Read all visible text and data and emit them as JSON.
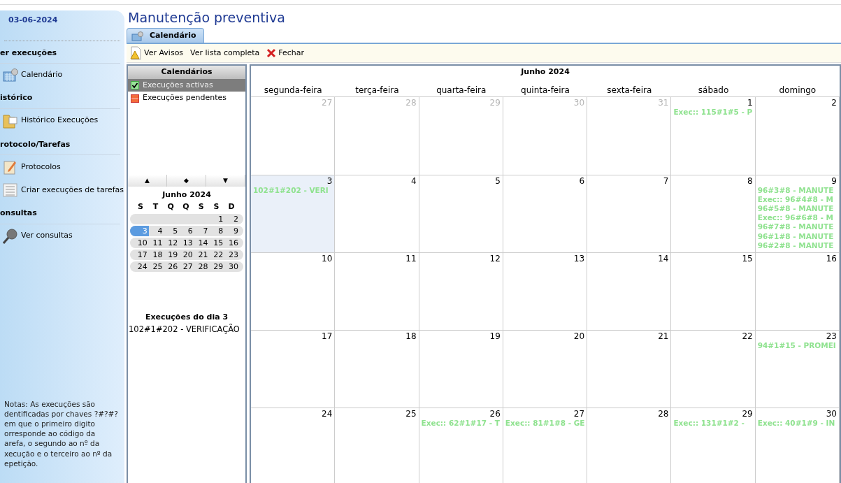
{
  "sidebar": {
    "date": "03-06-2024",
    "sections": [
      {
        "title": "er execuções",
        "items": [
          {
            "label": "Calendário",
            "kind": "calendar"
          }
        ]
      },
      {
        "title": "istórico",
        "items": [
          {
            "label": "Histórico Execuções",
            "kind": "folder"
          }
        ]
      },
      {
        "title": "rotocolo/Tarefas",
        "items": [
          {
            "label": "Protocolos",
            "kind": "clipboard"
          },
          {
            "label": "Criar execuções de tarefas",
            "kind": "list"
          }
        ]
      },
      {
        "title": "onsultas",
        "items": [
          {
            "label": "Ver consultas",
            "kind": "search"
          }
        ]
      }
    ],
    "notes_lines": [
      "Notas: As execuções são",
      "dentificadas por chaves ?#?#?",
      "em que o primeiro digito",
      "orresponde ao código da",
      "arefa, o segundo ao nº da",
      "xecução e o terceiro ao nº da",
      "epetição."
    ]
  },
  "title": "Manutenção preventiva",
  "tabs": [
    {
      "label": "Calendário",
      "selected": true
    }
  ],
  "toolbar": [
    {
      "label": "Ver Avisos",
      "kind": "warning"
    },
    {
      "label": "Ver lista completa",
      "kind": "plain"
    },
    {
      "label": "Fechar",
      "kind": "close"
    }
  ],
  "calendars": {
    "title": "Calendários",
    "items": [
      {
        "label": "Execuções activas",
        "kind": "active",
        "selected": true,
        "checked": true
      },
      {
        "label": "Execuções pendentes",
        "kind": "pending",
        "selected": false,
        "checked": false
      }
    ]
  },
  "nav_buttons": [
    "▲",
    "◆",
    "▼"
  ],
  "mini_calendar": {
    "title": "Junho 2024",
    "weekdays": [
      "S",
      "T",
      "Q",
      "Q",
      "S",
      "S",
      "D"
    ],
    "weeks": [
      {
        "kind": "first",
        "days": [
          {
            "day": "1",
            "selected": false
          },
          {
            "day": "2",
            "selected": false
          }
        ]
      },
      [
        {
          "day": "3",
          "selected": true
        },
        {
          "day": "4",
          "selected": false
        },
        {
          "day": "5",
          "selected": false
        },
        {
          "day": "6",
          "selected": false
        },
        {
          "day": "7",
          "selected": false
        },
        {
          "day": "8",
          "selected": false
        },
        {
          "day": "9",
          "selected": false
        }
      ],
      [
        {
          "day": "10",
          "selected": false
        },
        {
          "day": "11",
          "selected": false
        },
        {
          "day": "12",
          "selected": false
        },
        {
          "day": "13",
          "selected": false
        },
        {
          "day": "14",
          "selected": false
        },
        {
          "day": "15",
          "selected": false
        },
        {
          "day": "16",
          "selected": false
        }
      ],
      [
        {
          "day": "17",
          "selected": false
        },
        {
          "day": "18",
          "selected": false
        },
        {
          "day": "19",
          "selected": false
        },
        {
          "day": "20",
          "selected": false
        },
        {
          "day": "21",
          "selected": false
        },
        {
          "day": "22",
          "selected": false
        },
        {
          "day": "23",
          "selected": false
        }
      ],
      [
        {
          "day": "24",
          "selected": false
        },
        {
          "day": "25",
          "selected": false
        },
        {
          "day": "26",
          "selected": false
        },
        {
          "day": "27",
          "selected": false
        },
        {
          "day": "28",
          "selected": false
        },
        {
          "day": "29",
          "selected": false
        },
        {
          "day": "30",
          "selected": false
        }
      ]
    ]
  },
  "day_executions": {
    "title": "Execuções do dia 3",
    "items": [
      "102#1#202 - VERIFICAÇÃO"
    ]
  },
  "month_view": {
    "title": "Junho 2024",
    "weekdays": [
      "segunda-feira",
      "terça-feira",
      "quarta-feira",
      "quinta-feira",
      "sexta-feira",
      "sábado",
      "domingo"
    ],
    "weeks": [
      [
        {
          "day": "27",
          "other_month": true,
          "selected": false
        },
        {
          "day": "28",
          "other_month": true,
          "selected": false
        },
        {
          "day": "29",
          "other_month": true,
          "selected": false
        },
        {
          "day": "30",
          "other_month": true,
          "selected": false
        },
        {
          "day": "31",
          "other_month": true,
          "selected": false
        },
        {
          "day": "1",
          "other_month": false,
          "selected": false,
          "events": [
            "Exec:: 115#1#5 - P"
          ]
        },
        {
          "day": "2",
          "other_month": false,
          "selected": false
        }
      ],
      [
        {
          "day": "3",
          "other_month": false,
          "selected": true,
          "events": [
            "102#1#202 - VERI"
          ]
        },
        {
          "day": "4",
          "other_month": false,
          "selected": false
        },
        {
          "day": "5",
          "other_month": false,
          "selected": false
        },
        {
          "day": "6",
          "other_month": false,
          "selected": false
        },
        {
          "day": "7",
          "other_month": false,
          "selected": false
        },
        {
          "day": "8",
          "other_month": false,
          "selected": false
        },
        {
          "day": "9",
          "other_month": false,
          "selected": false,
          "events": [
            "96#3#8 - MANUTE",
            "Exec:: 96#4#8 - M",
            "96#5#8 - MANUTE",
            "Exec:: 96#6#8 - M",
            "96#7#8 - MANUTE",
            "96#1#8 - MANUTE",
            "96#2#8 - MANUTE"
          ]
        }
      ],
      [
        {
          "day": "10",
          "other_month": false,
          "selected": false
        },
        {
          "day": "11",
          "other_month": false,
          "selected": false
        },
        {
          "day": "12",
          "other_month": false,
          "selected": false
        },
        {
          "day": "13",
          "other_month": false,
          "selected": false
        },
        {
          "day": "14",
          "other_month": false,
          "selected": false
        },
        {
          "day": "15",
          "other_month": false,
          "selected": false
        },
        {
          "day": "16",
          "other_month": false,
          "selected": false
        }
      ],
      [
        {
          "day": "17",
          "other_month": false,
          "selected": false
        },
        {
          "day": "18",
          "other_month": false,
          "selected": false
        },
        {
          "day": "19",
          "other_month": false,
          "selected": false
        },
        {
          "day": "20",
          "other_month": false,
          "selected": false
        },
        {
          "day": "21",
          "other_month": false,
          "selected": false
        },
        {
          "day": "22",
          "other_month": false,
          "selected": false
        },
        {
          "day": "23",
          "other_month": false,
          "selected": false,
          "events": [
            "94#1#15 - PROMEI"
          ]
        }
      ],
      [
        {
          "day": "24",
          "other_month": false,
          "selected": false
        },
        {
          "day": "25",
          "other_month": false,
          "selected": false
        },
        {
          "day": "26",
          "other_month": false,
          "selected": false,
          "events": [
            "Exec:: 62#1#17 - T"
          ]
        },
        {
          "day": "27",
          "other_month": false,
          "selected": false,
          "events": [
            "Exec:: 81#1#8 - GE"
          ]
        },
        {
          "day": "28",
          "other_month": false,
          "selected": false
        },
        {
          "day": "29",
          "other_month": false,
          "selected": false,
          "events": [
            "Exec:: 131#1#2 -"
          ]
        },
        {
          "day": "30",
          "other_month": false,
          "selected": false,
          "events": [
            "Exec:: 40#1#9 - IN"
          ]
        }
      ]
    ]
  }
}
